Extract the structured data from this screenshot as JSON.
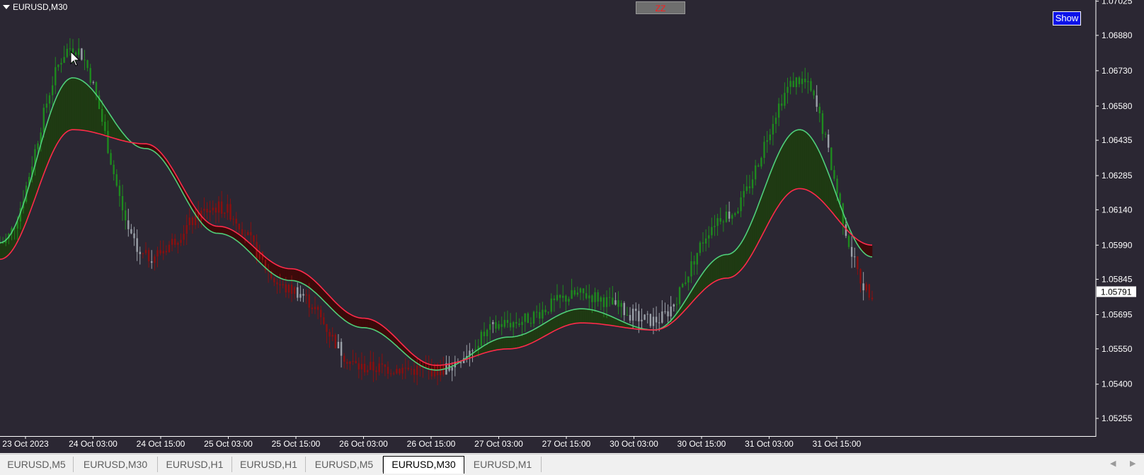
{
  "window": {
    "symbol_title": "EURUSD,M30",
    "zz_button": "ZZ",
    "show_button": "Show",
    "colors": {
      "background": "#2b2733",
      "bull_candle": "#1e8a1e",
      "bear_candle": "#8a0f0f",
      "neutral_candle": "#9aa0a8",
      "fast_line_up": "#4fcf7a",
      "slow_line_down": "#ff2a4a",
      "bull_fill": "#1f3a13",
      "bear_fill": "#3d0a0a",
      "axis_text": "#ffffff",
      "current_price_box": "#ffffff"
    }
  },
  "tabs": [
    {
      "label": "EURUSD,M5",
      "active": false
    },
    {
      "label": "EURUSD,M30",
      "active": false
    },
    {
      "label": "EURUSD,H1",
      "active": false
    },
    {
      "label": "EURUSD,H1",
      "active": false
    },
    {
      "label": "EURUSD,M5",
      "active": false
    },
    {
      "label": "EURUSD,M30",
      "active": true
    },
    {
      "label": "EURUSD,M1",
      "active": false
    }
  ],
  "tab_scroll": {
    "left_icon": "chevron-left-icon",
    "right_icon": "chevron-right-icon"
  },
  "chart_data": {
    "type": "line",
    "symbol": "EURUSD",
    "timeframe": "M30",
    "current_price": "1.05791",
    "ylim": [
      1.0518,
      1.0703
    ],
    "y_ticks": [
      "1.07025",
      "1.06880",
      "1.06730",
      "1.06580",
      "1.06435",
      "1.06285",
      "1.06140",
      "1.05990",
      "1.05845",
      "1.05695",
      "1.05550",
      "1.05400",
      "1.05255"
    ],
    "x_ticks": [
      "23 Oct 2023",
      "24 Oct 03:00",
      "24 Oct 15:00",
      "25 Oct 03:00",
      "25 Oct 15:00",
      "26 Oct 03:00",
      "26 Oct 15:00",
      "27 Oct 03:00",
      "27 Oct 15:00",
      "30 Oct 03:00",
      "30 Oct 15:00",
      "31 Oct 03:00",
      "31 Oct 15:00"
    ],
    "grid": false,
    "x": [
      0,
      1,
      2,
      3,
      4,
      5,
      6,
      7,
      8,
      9,
      10,
      11,
      12
    ],
    "price_path": [
      1.06,
      1.0683,
      1.0594,
      1.0615,
      1.058,
      1.0547,
      1.0546,
      1.0566,
      1.0578,
      1.0567,
      1.0612,
      1.0669,
      1.0579
    ],
    "series": [
      {
        "name": "",
        "values": [
          1.06,
          1.067,
          1.064,
          1.0604,
          1.0584,
          1.0564,
          1.0546,
          1.056,
          1.0572,
          1.0563,
          1.0595,
          1.0648,
          1.0594
        ]
      },
      {
        "name": "",
        "values": [
          1.0593,
          1.0648,
          1.0642,
          1.0607,
          1.0589,
          1.0568,
          1.0548,
          1.0555,
          1.0566,
          1.0563,
          1.0585,
          1.0623,
          1.0599
        ]
      }
    ]
  }
}
